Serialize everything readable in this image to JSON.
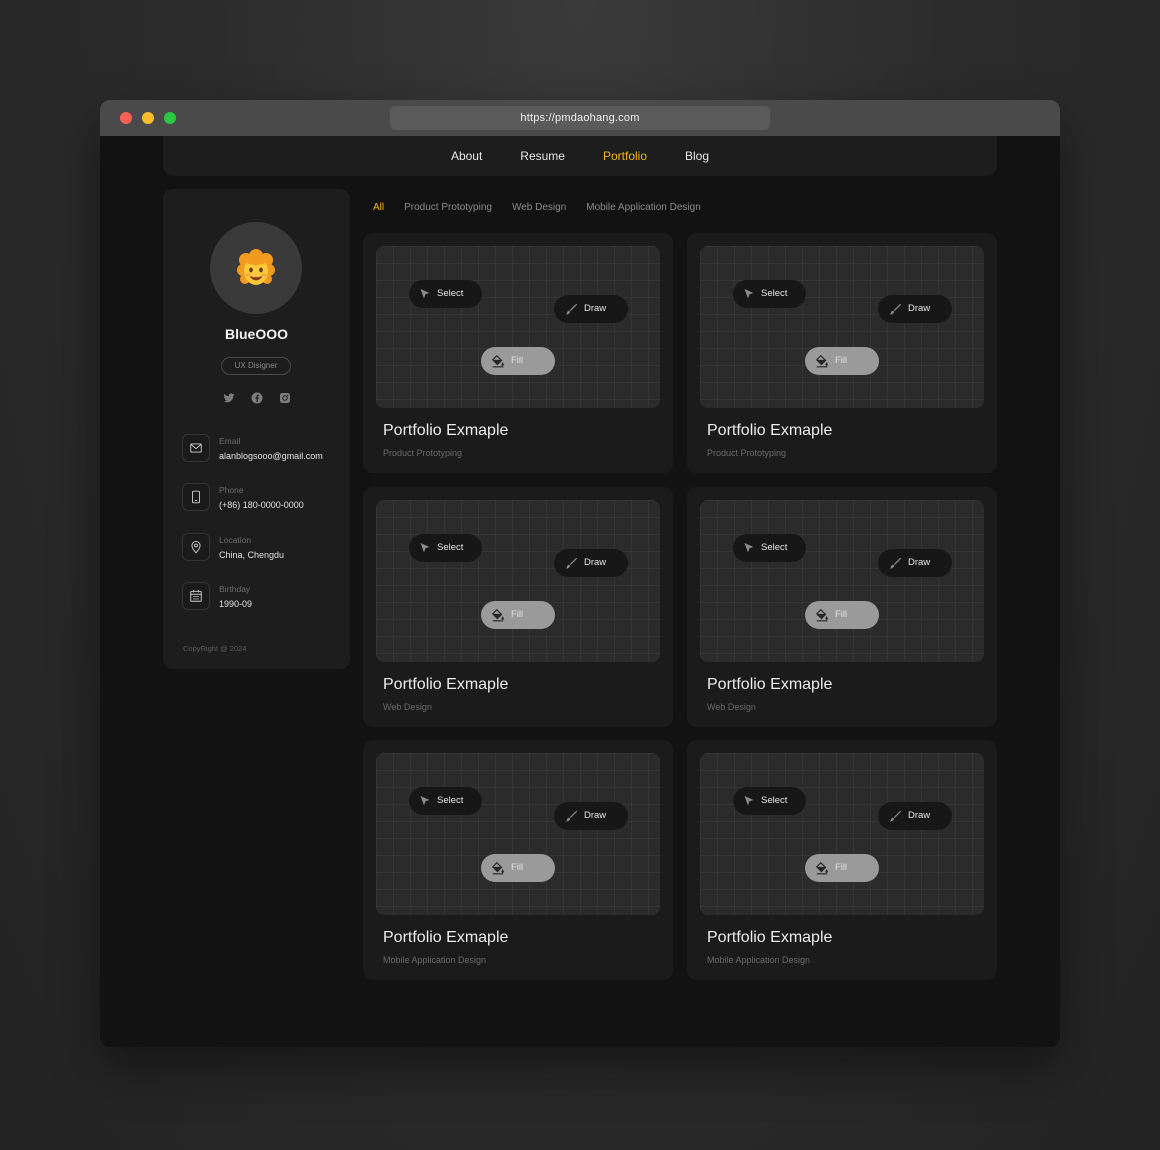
{
  "browser": {
    "url": "https://pmdaohang.com"
  },
  "nav": {
    "items": [
      {
        "label": "About",
        "active": false
      },
      {
        "label": "Resume",
        "active": false
      },
      {
        "label": "Portfolio",
        "active": true
      },
      {
        "label": "Blog",
        "active": false
      }
    ]
  },
  "profile": {
    "name": "BlueOOO",
    "role": "UX Disigner",
    "socials": [
      "twitter-icon",
      "facebook-icon",
      "instagram-icon"
    ],
    "info": [
      {
        "icon": "mail-icon",
        "label": "Email",
        "value": "alanblogsooo@gmail.com"
      },
      {
        "icon": "phone-icon",
        "label": "Phone",
        "value": "(+86) 180-0000-0000"
      },
      {
        "icon": "location-icon",
        "label": "Location",
        "value": "China, Chengdu"
      },
      {
        "icon": "calendar-icon",
        "label": "Birthday",
        "value": "1990-09"
      }
    ],
    "copyright": "CopyRight @ 2024"
  },
  "filters": [
    {
      "label": "All",
      "active": true
    },
    {
      "label": "Product Prototyping",
      "active": false
    },
    {
      "label": "Web Design",
      "active": false
    },
    {
      "label": "Mobile Application Design",
      "active": false
    }
  ],
  "tools": {
    "select": "Select",
    "draw": "Draw",
    "fill": "Fill"
  },
  "cards": [
    {
      "title": "Portfolio Exmaple",
      "category": "Product Prototyping"
    },
    {
      "title": "Portfolio Exmaple",
      "category": "Product Prototyping"
    },
    {
      "title": "Portfolio Exmaple",
      "category": "Web Design"
    },
    {
      "title": "Portfolio Exmaple",
      "category": "Web Design"
    },
    {
      "title": "Portfolio Exmaple",
      "category": "Mobile Application Design"
    },
    {
      "title": "Portfolio Exmaple",
      "category": "Mobile Application Design"
    }
  ],
  "colors": {
    "accent": "#f5b514",
    "background": "#121212",
    "card": "#1b1b1b"
  }
}
